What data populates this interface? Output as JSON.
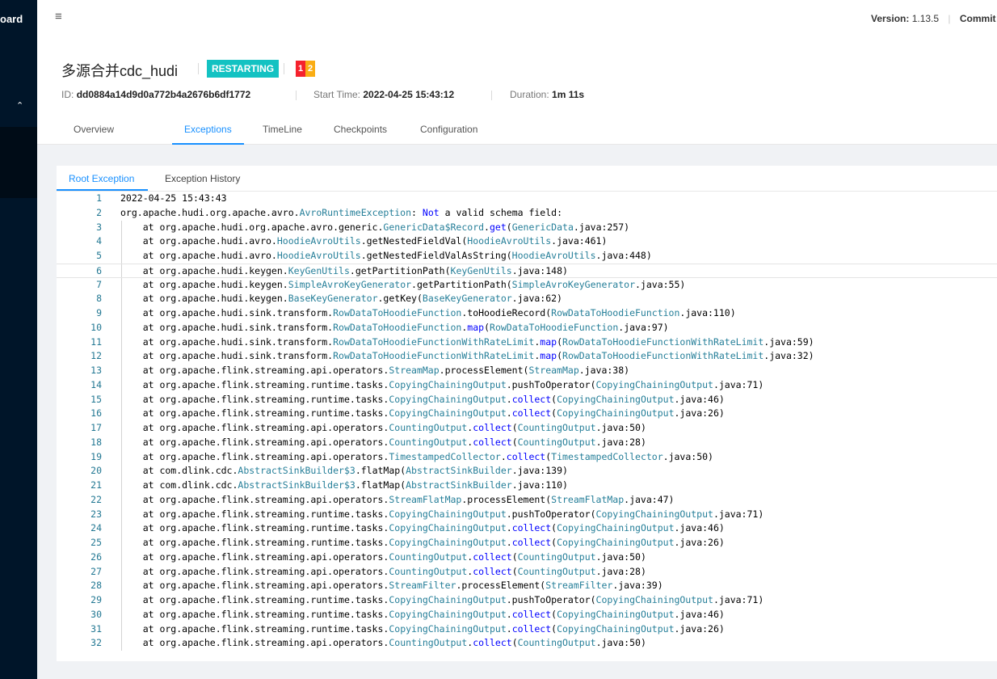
{
  "sidebar": {
    "logo": "oard"
  },
  "header": {
    "version_label": "Version:",
    "version_value": "1.13.5",
    "commit_label": "Commit"
  },
  "job": {
    "name": "多源合并cdc_hudi",
    "status": "RESTARTING",
    "status_color": "#13c2c2",
    "task_badges": [
      {
        "count": "1",
        "color": "#f5222d"
      },
      {
        "count": "2",
        "color": "#faad14"
      }
    ],
    "id_label": "ID:",
    "id_value": "dd0884a14d9d0a772b4a2676b6df1772",
    "start_label": "Start Time:",
    "start_value": "2022-04-25 15:43:12",
    "duration_label": "Duration:",
    "duration_value": "1m 11s"
  },
  "tabs": [
    "Overview",
    "Exceptions",
    "TimeLine",
    "Checkpoints",
    "Configuration"
  ],
  "active_tab": "Exceptions",
  "subtabs": [
    "Root Exception",
    "Exception History"
  ],
  "active_subtab": "Root Exception",
  "editor": {
    "current_line": 6,
    "lines": [
      "2022-04-25 15:43:43",
      "org.apache.hudi.org.apache.avro.AvroRuntimeException: Not a valid schema field:",
      "    at org.apache.hudi.org.apache.avro.generic.GenericData$Record.get(GenericData.java:257)",
      "    at org.apache.hudi.avro.HoodieAvroUtils.getNestedFieldVal(HoodieAvroUtils.java:461)",
      "    at org.apache.hudi.avro.HoodieAvroUtils.getNestedFieldValAsString(HoodieAvroUtils.java:448)",
      "    at org.apache.hudi.keygen.KeyGenUtils.getPartitionPath(KeyGenUtils.java:148)",
      "    at org.apache.hudi.keygen.SimpleAvroKeyGenerator.getPartitionPath(SimpleAvroKeyGenerator.java:55)",
      "    at org.apache.hudi.keygen.BaseKeyGenerator.getKey(BaseKeyGenerator.java:62)",
      "    at org.apache.hudi.sink.transform.RowDataToHoodieFunction.toHoodieRecord(RowDataToHoodieFunction.java:110)",
      "    at org.apache.hudi.sink.transform.RowDataToHoodieFunction.map(RowDataToHoodieFunction.java:97)",
      "    at org.apache.hudi.sink.transform.RowDataToHoodieFunctionWithRateLimit.map(RowDataToHoodieFunctionWithRateLimit.java:59)",
      "    at org.apache.hudi.sink.transform.RowDataToHoodieFunctionWithRateLimit.map(RowDataToHoodieFunctionWithRateLimit.java:32)",
      "    at org.apache.flink.streaming.api.operators.StreamMap.processElement(StreamMap.java:38)",
      "    at org.apache.flink.streaming.runtime.tasks.CopyingChainingOutput.pushToOperator(CopyingChainingOutput.java:71)",
      "    at org.apache.flink.streaming.runtime.tasks.CopyingChainingOutput.collect(CopyingChainingOutput.java:46)",
      "    at org.apache.flink.streaming.runtime.tasks.CopyingChainingOutput.collect(CopyingChainingOutput.java:26)",
      "    at org.apache.flink.streaming.api.operators.CountingOutput.collect(CountingOutput.java:50)",
      "    at org.apache.flink.streaming.api.operators.CountingOutput.collect(CountingOutput.java:28)",
      "    at org.apache.flink.streaming.api.operators.TimestampedCollector.collect(TimestampedCollector.java:50)",
      "    at com.dlink.cdc.AbstractSinkBuilder$3.flatMap(AbstractSinkBuilder.java:139)",
      "    at com.dlink.cdc.AbstractSinkBuilder$3.flatMap(AbstractSinkBuilder.java:110)",
      "    at org.apache.flink.streaming.api.operators.StreamFlatMap.processElement(StreamFlatMap.java:47)",
      "    at org.apache.flink.streaming.runtime.tasks.CopyingChainingOutput.pushToOperator(CopyingChainingOutput.java:71)",
      "    at org.apache.flink.streaming.runtime.tasks.CopyingChainingOutput.collect(CopyingChainingOutput.java:46)",
      "    at org.apache.flink.streaming.runtime.tasks.CopyingChainingOutput.collect(CopyingChainingOutput.java:26)",
      "    at org.apache.flink.streaming.api.operators.CountingOutput.collect(CountingOutput.java:50)",
      "    at org.apache.flink.streaming.api.operators.CountingOutput.collect(CountingOutput.java:28)",
      "    at org.apache.flink.streaming.api.operators.StreamFilter.processElement(StreamFilter.java:39)",
      "    at org.apache.flink.streaming.runtime.tasks.CopyingChainingOutput.pushToOperator(CopyingChainingOutput.java:71)",
      "    at org.apache.flink.streaming.runtime.tasks.CopyingChainingOutput.collect(CopyingChainingOutput.java:46)",
      "    at org.apache.flink.streaming.runtime.tasks.CopyingChainingOutput.collect(CopyingChainingOutput.java:26)",
      "    at org.apache.flink.streaming.api.operators.CountingOutput.collect(CountingOutput.java:50)"
    ]
  }
}
